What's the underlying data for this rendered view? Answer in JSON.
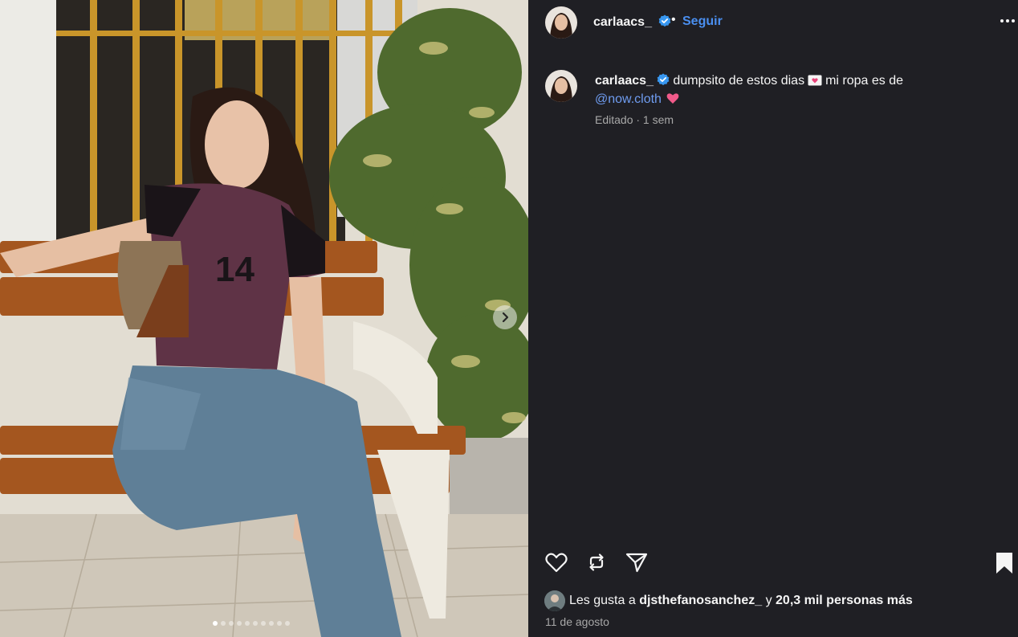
{
  "post": {
    "author": "carlaacs_",
    "follow_label": "Seguir",
    "separator": "•",
    "more_label": "Más opciones"
  },
  "caption": {
    "username": "carlaacs_",
    "text_part1": "dumpsito de estos dias",
    "text_part2": "mi ropa es de",
    "mention": "@now.cloth",
    "meta": "Editado · 1 sem"
  },
  "media": {
    "jersey_number": "14",
    "slide_count": 10,
    "active_slide": 1
  },
  "actions": {
    "like_icon": "heart-icon",
    "repost_icon": "repost-icon",
    "share_icon": "send-icon",
    "save_icon": "bookmark-icon"
  },
  "likes": {
    "prefix": "Les gusta a",
    "user": "djsthefanosanchez_",
    "connector": "y",
    "others": "20,3 mil personas más"
  },
  "date": "11 de agosto",
  "colors": {
    "background": "#1f1f24",
    "accent_blue": "#4a8ff0",
    "mention_blue": "#6f9cf0",
    "muted": "#a8a8a8",
    "verified": "#3897f0"
  }
}
